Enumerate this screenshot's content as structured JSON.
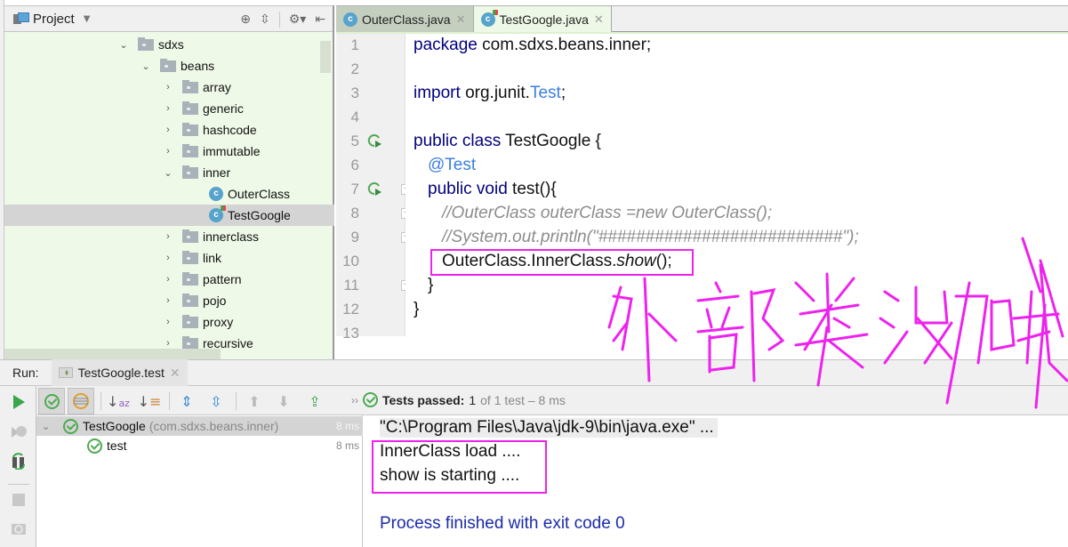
{
  "project_panel": {
    "title": "Project",
    "dropdown_icon": "chevron-down-icon",
    "tools": [
      "locate-icon",
      "collapse-icon",
      "gear-icon",
      "hide-icon"
    ],
    "tree": [
      {
        "label": "sdxs",
        "type": "folder",
        "expanded": true,
        "depth": 0
      },
      {
        "label": "beans",
        "type": "folder",
        "expanded": true,
        "depth": 1
      },
      {
        "label": "array",
        "type": "folder",
        "expanded": false,
        "depth": 2
      },
      {
        "label": "generic",
        "type": "folder",
        "expanded": false,
        "depth": 2
      },
      {
        "label": "hashcode",
        "type": "folder",
        "expanded": false,
        "depth": 2
      },
      {
        "label": "immutable",
        "type": "folder",
        "expanded": false,
        "depth": 2
      },
      {
        "label": "inner",
        "type": "folder",
        "expanded": true,
        "depth": 2
      },
      {
        "label": "OuterClass",
        "type": "class",
        "depth": 3
      },
      {
        "label": "TestGoogle",
        "type": "test-class",
        "depth": 3,
        "selected": true
      },
      {
        "label": "innerclass",
        "type": "folder",
        "expanded": false,
        "depth": 2
      },
      {
        "label": "link",
        "type": "folder",
        "expanded": false,
        "depth": 2
      },
      {
        "label": "pattern",
        "type": "folder",
        "expanded": false,
        "depth": 2
      },
      {
        "label": "pojo",
        "type": "folder",
        "expanded": false,
        "depth": 2
      },
      {
        "label": "proxy",
        "type": "folder",
        "expanded": false,
        "depth": 2
      },
      {
        "label": "recursive",
        "type": "folder",
        "expanded": false,
        "depth": 2
      }
    ]
  },
  "editor": {
    "tabs": [
      {
        "label": "OuterClass.java",
        "active": false
      },
      {
        "label": "TestGoogle.java",
        "active": true
      }
    ],
    "line_numbers": [
      "1",
      "2",
      "3",
      "4",
      "5",
      "6",
      "7",
      "8",
      "9",
      "10",
      "11",
      "12",
      "13"
    ],
    "lines": {
      "l1_kw": "package",
      "l1_rest": " com.sdxs.beans.inner;",
      "l3_kw": "import",
      "l3_rest": " org.junit.",
      "l3_type": "Test",
      "l3_end": ";",
      "l5_kw": "public class",
      "l5_rest": " TestGoogle {",
      "l6_ann": "@Test",
      "l7_kw": "public void",
      "l7_rest": " test(){",
      "l8_cmt": "//OuterClass outerClass =new OuterClass();",
      "l9_cmt": "//System.out.println(\"##########################\");",
      "l10_a": "OuterClass.InnerClass.",
      "l10_b": "show",
      "l10_c": "();",
      "l11": "}",
      "l12": "}"
    }
  },
  "annotation": {
    "handwritten_text": "外部类没加载",
    "color": "#ee22ee"
  },
  "run_panel": {
    "label": "Run:",
    "tab_label": "TestGoogle.test",
    "status": {
      "prefix": "Tests passed:",
      "passed": "1",
      "suffix": "of 1 test – 8 ms"
    },
    "test_tree": [
      {
        "name": "TestGoogle",
        "package": "(com.sdxs.beans.inner)",
        "time": "8 ms",
        "selected": true
      },
      {
        "name": "test",
        "time": "8 ms",
        "selected": false
      }
    ],
    "console": {
      "command": "\"C:\\Program Files\\Java\\jdk-9\\bin\\java.exe\" ...",
      "output": [
        "InnerClass load ....",
        "show is starting ...."
      ],
      "exit": "Process finished with exit code 0"
    }
  }
}
